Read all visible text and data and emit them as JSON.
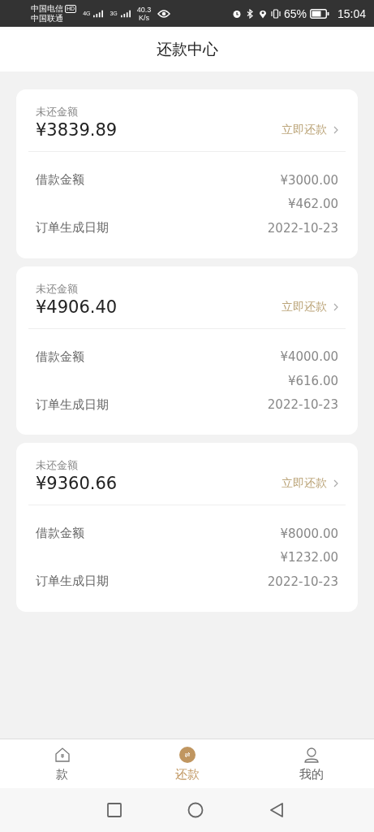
{
  "status_bar": {
    "carrier_1": "中国电信",
    "hd_badge": "HD",
    "carrier_2": "中国联通",
    "network_1": "4G",
    "network_2": "3G",
    "speed": "40.3",
    "speed_unit": "K/s",
    "battery": "65%",
    "time": "15:04"
  },
  "title": "还款中心",
  "orders": [
    {
      "due_label": "未还金额",
      "due_amount": "¥3839.89",
      "action": "立即还款",
      "rows": [
        {
          "label": "借款金额",
          "value": "¥3000.00"
        },
        {
          "value": "¥462.00"
        },
        {
          "label": "订单生成日期",
          "value": "2022-10-23"
        }
      ]
    },
    {
      "due_label": "未还金额",
      "due_amount": "¥4906.40",
      "action": "立即还款",
      "rows": [
        {
          "label": "借款金额",
          "value": "¥4000.00"
        },
        {
          "value": "¥616.00"
        },
        {
          "label": "订单生成日期",
          "value": "2022-10-23"
        }
      ]
    },
    {
      "due_label": "未还金额",
      "due_amount": "¥9360.66",
      "action": "立即还款",
      "rows": [
        {
          "label": "借款金额",
          "value": "¥8000.00"
        },
        {
          "value": "¥1232.00"
        },
        {
          "label": "订单生成日期",
          "value": "2022-10-23"
        }
      ]
    }
  ],
  "tabs": [
    {
      "kind": "home",
      "label": "款",
      "selected": false
    },
    {
      "kind": "repay",
      "label": "还款",
      "selected": true
    },
    {
      "kind": "me",
      "label": "我的",
      "selected": false
    }
  ]
}
